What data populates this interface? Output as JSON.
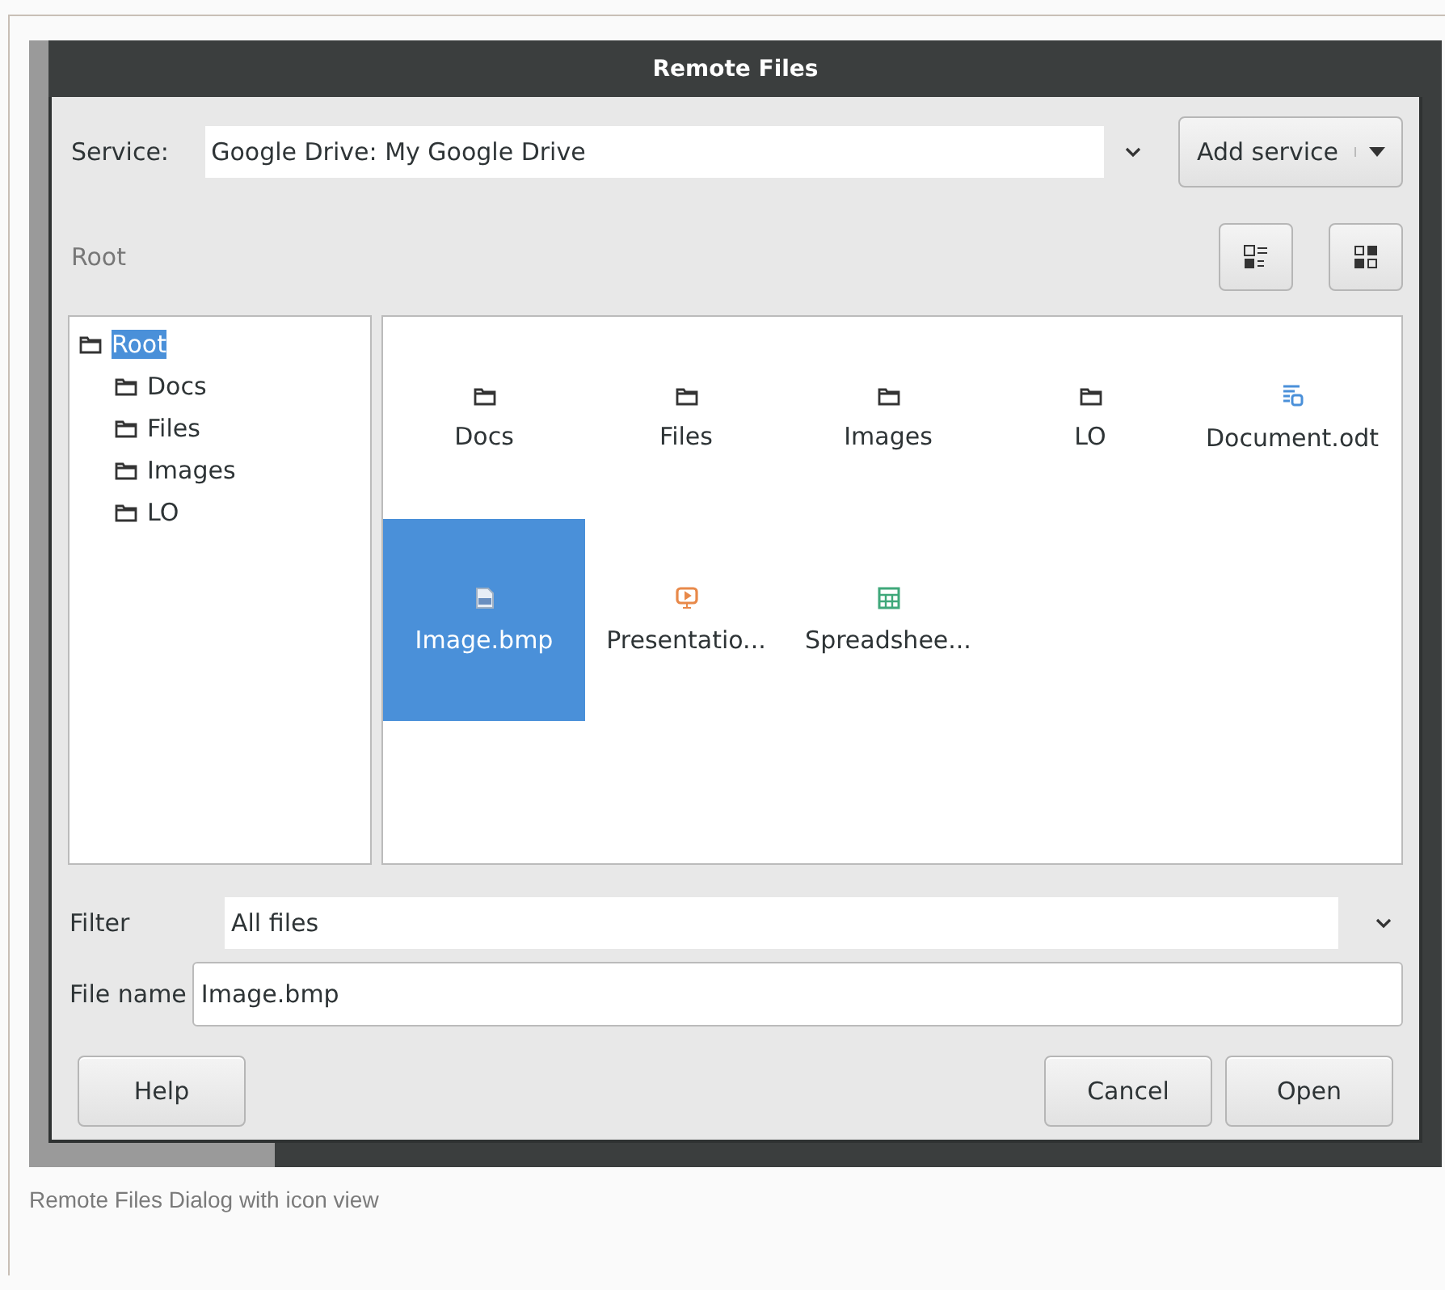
{
  "window": {
    "title": "Remote Files"
  },
  "service": {
    "label": "Service:",
    "value": "Google Drive: My Google Drive",
    "add_button": "Add service"
  },
  "path": "Root",
  "view_buttons": [
    {
      "kind": "list"
    },
    {
      "kind": "icons"
    }
  ],
  "tree": [
    {
      "label": "Root",
      "selected": true,
      "children": [
        {
          "label": "Docs",
          "selected": false
        },
        {
          "label": "Files",
          "selected": false
        },
        {
          "label": "Images",
          "selected": false
        },
        {
          "label": "LO",
          "selected": false
        }
      ]
    }
  ],
  "files": [
    {
      "name": "Docs",
      "kind": "folder",
      "selected": false
    },
    {
      "name": "Files",
      "kind": "folder",
      "selected": false
    },
    {
      "name": "Images",
      "kind": "folder",
      "selected": false
    },
    {
      "name": "LO",
      "kind": "folder",
      "selected": false
    },
    {
      "name": "Document.odt",
      "kind": "document",
      "selected": false
    },
    {
      "name": "Image.bmp",
      "kind": "image",
      "selected": true
    },
    {
      "name": "Presentatio...",
      "kind": "presentation",
      "selected": false
    },
    {
      "name": "Spreadshee...",
      "kind": "spreadsheet",
      "selected": false
    }
  ],
  "filter": {
    "label": "Filter",
    "value": "All files"
  },
  "file_name": {
    "label": "File name",
    "value": "Image.bmp"
  },
  "buttons": [
    {
      "label": "Help",
      "kind": "left"
    },
    {
      "label": "Cancel",
      "kind": "right"
    },
    {
      "label": "Open",
      "kind": "right"
    }
  ],
  "caption": "Remote Files Dialog with icon view"
}
